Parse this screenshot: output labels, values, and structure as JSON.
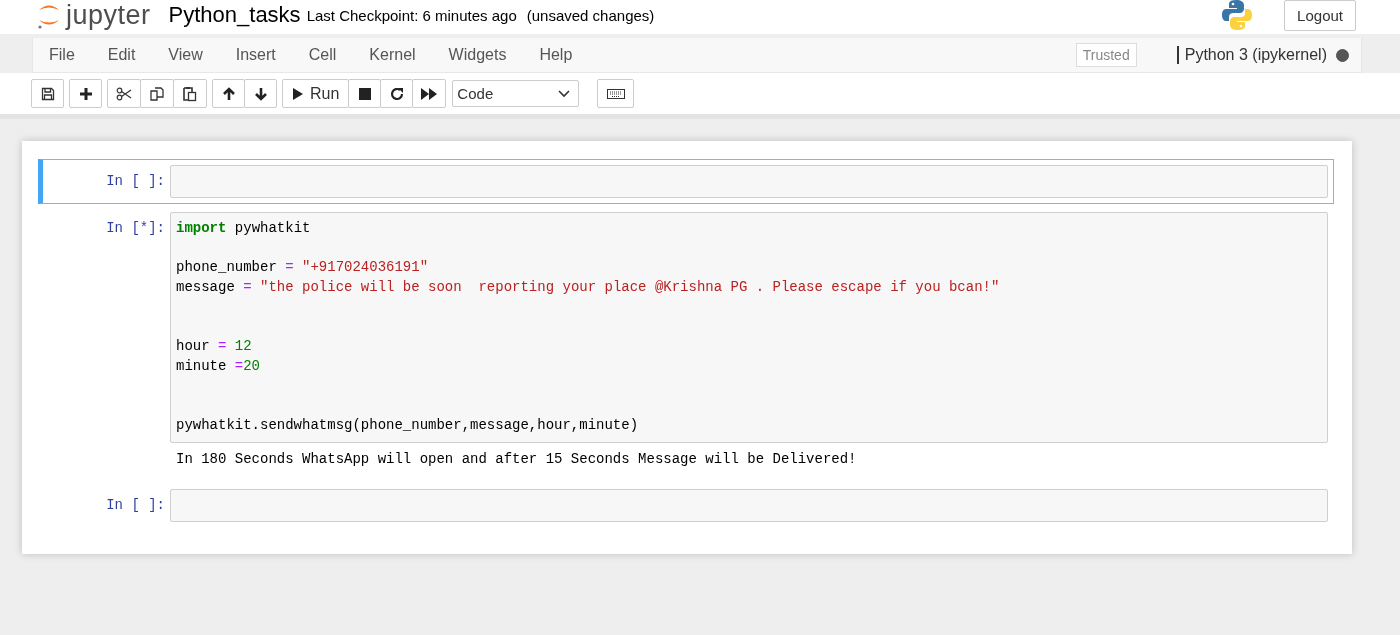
{
  "header": {
    "logo_text": "jupyter",
    "notebook_name": "Python_tasks",
    "checkpoint": "Last Checkpoint: 6 minutes ago",
    "save_status": "(unsaved changes)",
    "logout": "Logout"
  },
  "menu": [
    "File",
    "Edit",
    "View",
    "Insert",
    "Cell",
    "Kernel",
    "Widgets",
    "Help"
  ],
  "trusted": "Trusted",
  "kernel": {
    "name": "Python 3 (ipykernel)",
    "busy": true
  },
  "toolbar": {
    "run_label": "Run",
    "cell_type": "Code"
  },
  "cells": [
    {
      "prompt": "In [ ]:",
      "selected": true
    },
    {
      "prompt": "In [*]:",
      "selected": false,
      "lines": [
        {
          "kind": "code",
          "tokens": [
            {
              "kind": "keyword",
              "text": "import"
            },
            {
              "kind": "name",
              "text": " pywhatkit"
            }
          ]
        },
        {
          "kind": "blank"
        },
        {
          "kind": "code",
          "tokens": [
            {
              "kind": "name",
              "text": "phone_number "
            },
            {
              "kind": "op",
              "text": "="
            },
            {
              "kind": "string",
              "text": " \"+917024036191\""
            }
          ]
        },
        {
          "kind": "code",
          "tokens": [
            {
              "kind": "name",
              "text": "message "
            },
            {
              "kind": "op",
              "text": "="
            },
            {
              "kind": "string",
              "text": " \"the police will be soon  reporting your place @Krishna PG . Please escape if you bcan!\""
            }
          ]
        },
        {
          "kind": "blank"
        },
        {
          "kind": "blank"
        },
        {
          "kind": "code",
          "tokens": [
            {
              "kind": "name",
              "text": "hour "
            },
            {
              "kind": "op",
              "text": "="
            },
            {
              "kind": "number",
              "text": " 12"
            }
          ]
        },
        {
          "kind": "code",
          "tokens": [
            {
              "kind": "name",
              "text": "minute "
            },
            {
              "kind": "op",
              "text": "="
            },
            {
              "kind": "number",
              "text": "20"
            }
          ]
        },
        {
          "kind": "blank"
        },
        {
          "kind": "blank"
        },
        {
          "kind": "code",
          "tokens": [
            {
              "kind": "name",
              "text": "pywhatkit.sendwhatmsg(phone_number,message,hour,minute)"
            }
          ]
        }
      ],
      "output": "In 180 Seconds WhatsApp will open and after 15 Seconds Message will be Delivered!"
    },
    {
      "prompt": "In [ ]:",
      "selected": false
    }
  ]
}
